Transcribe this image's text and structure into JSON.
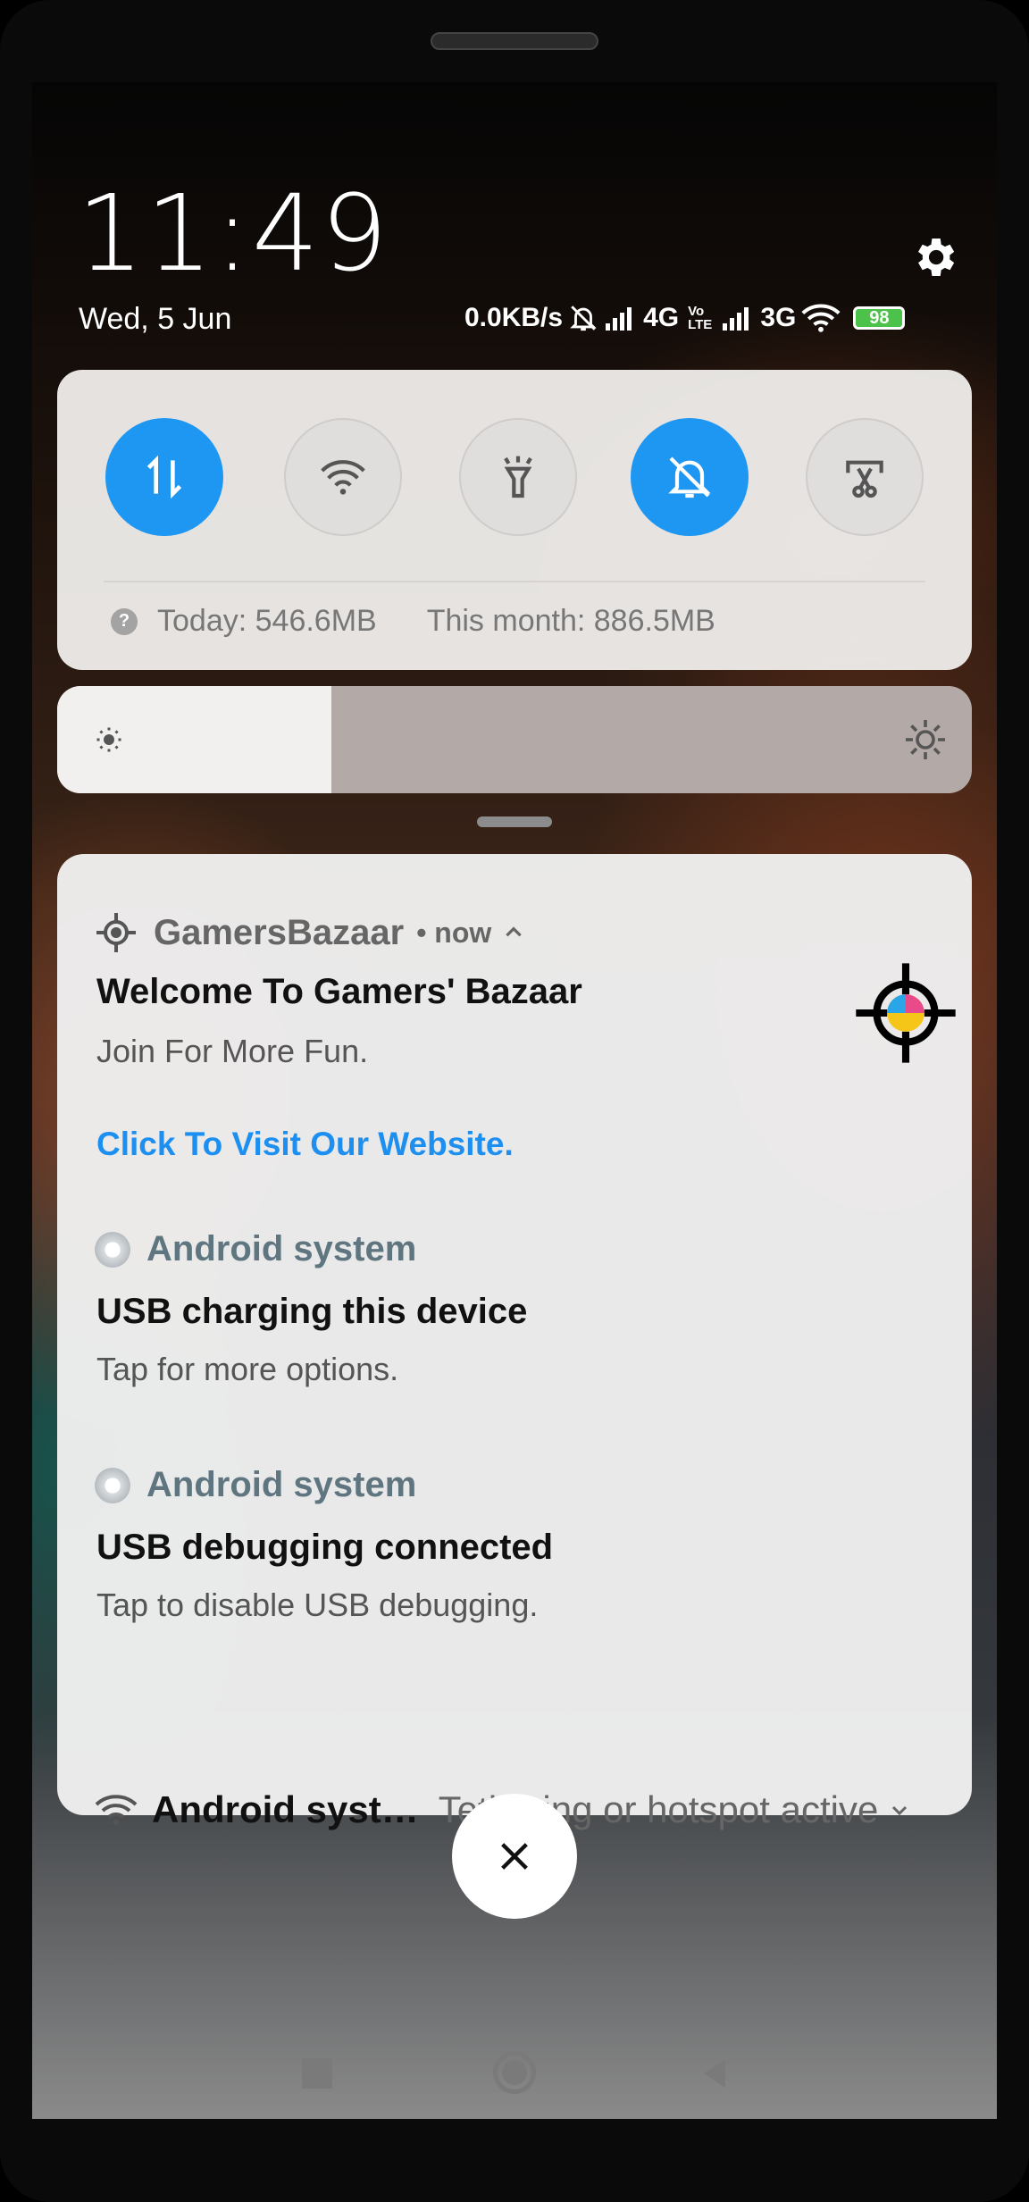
{
  "status_bar": {
    "time": "11:49",
    "date": "Wed, 5 Jun",
    "net_speed": "0.0KB/s",
    "net1": "4G",
    "volte_top": "Vo",
    "volte_bottom": "LTE",
    "net2": "3G",
    "battery": "98"
  },
  "quick_settings": {
    "toggles": [
      {
        "icon": "mobile-data-icon",
        "state": "on"
      },
      {
        "icon": "wifi-icon",
        "state": "off"
      },
      {
        "icon": "flashlight-icon",
        "state": "off"
      },
      {
        "icon": "silent-mode-icon",
        "state": "on"
      },
      {
        "icon": "screenshot-icon",
        "state": "off"
      }
    ],
    "data_today": "Today: 546.6MB",
    "data_month": "This month: 886.5MB",
    "brightness_level": 0.3
  },
  "notifications": {
    "gamers": {
      "app": "GamersBazaar",
      "time": "• now",
      "title": "Welcome To Gamers' Bazaar",
      "text": "Join For More Fun.",
      "link": "Click To Visit Our Website."
    },
    "usb_charging": {
      "app": "Android system",
      "title": "USB charging this device",
      "text": "Tap for more options."
    },
    "usb_debugging": {
      "app": "Android system",
      "title": "USB debugging connected",
      "text": "Tap to disable USB debugging."
    },
    "tethering": {
      "app": "Android syst…",
      "text": "Tethering or hotspot active"
    }
  },
  "colors": {
    "accent": "#1e97f3",
    "battery": "#4cc24a",
    "link": "#1d8ff0"
  }
}
